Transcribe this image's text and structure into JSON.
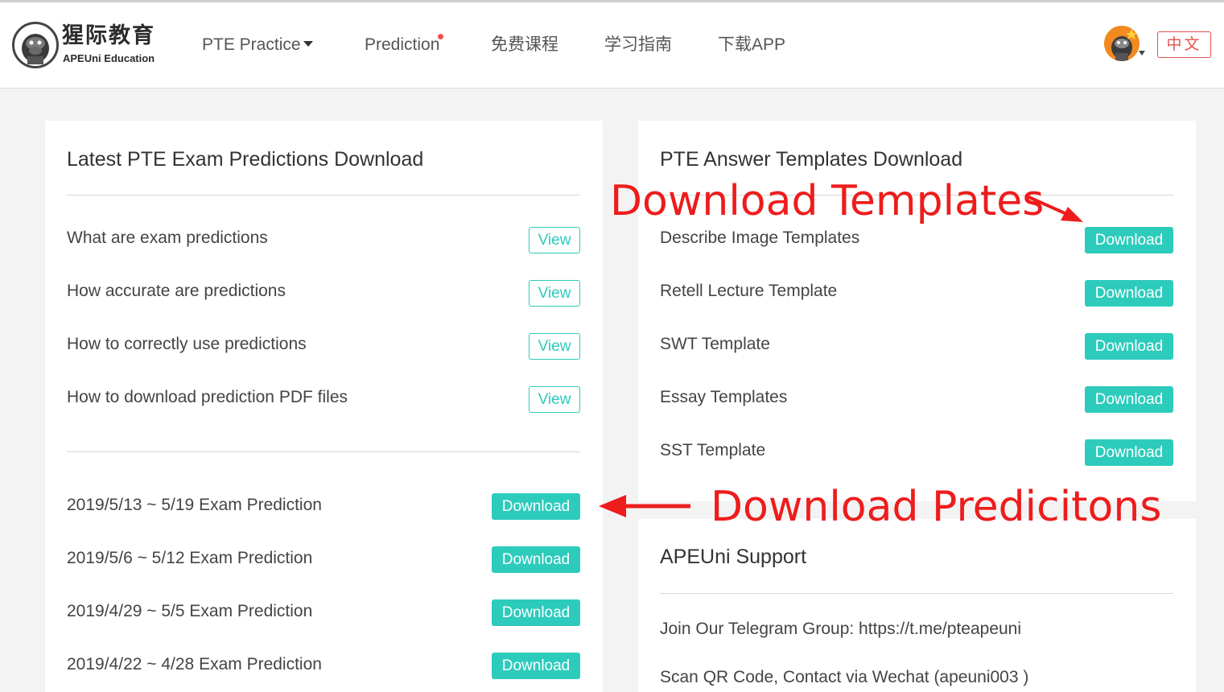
{
  "header": {
    "logo_cn": "猩际教育",
    "logo_en": "APEUni Education",
    "nav": [
      {
        "label": "PTE Practice",
        "has_caret": true
      },
      {
        "label": "Prediction",
        "has_dot": true
      },
      {
        "label": "免费课程"
      },
      {
        "label": "学习指南"
      },
      {
        "label": "下载APP"
      }
    ],
    "lang_button": "中文"
  },
  "predictions_card": {
    "title": "Latest PTE Exam Predictions Download",
    "info_rows": [
      {
        "label": "What are exam predictions",
        "button": "View"
      },
      {
        "label": "How accurate are predictions",
        "button": "View"
      },
      {
        "label": "How to correctly use predictions",
        "button": "View"
      },
      {
        "label": "How to download prediction PDF files",
        "button": "View"
      }
    ],
    "download_rows": [
      {
        "label": "2019/5/13 ~ 5/19 Exam Prediction",
        "button": "Download"
      },
      {
        "label": "2019/5/6 ~ 5/12 Exam Prediction",
        "button": "Download"
      },
      {
        "label": "2019/4/29 ~ 5/5 Exam Prediction",
        "button": "Download"
      },
      {
        "label": "2019/4/22 ~ 4/28 Exam Prediction",
        "button": "Download"
      }
    ]
  },
  "templates_card": {
    "title": "PTE Answer Templates Download",
    "rows": [
      {
        "label": "Describe Image Templates",
        "button": "Download"
      },
      {
        "label": "Retell Lecture Template",
        "button": "Download"
      },
      {
        "label": "SWT Template",
        "button": "Download"
      },
      {
        "label": "Essay Templates",
        "button": "Download"
      },
      {
        "label": "SST Template",
        "button": "Download"
      }
    ]
  },
  "support_card": {
    "title": "APEUni Support",
    "lines": [
      "Join Our Telegram Group: https://t.me/pteapeuni",
      "Scan QR Code, Contact via Wechat (apeuni003 )"
    ]
  },
  "annotations": {
    "templates": "Download Templates",
    "predictions": "Download Predicitons"
  },
  "colors": {
    "accent": "#2dcbbc",
    "annotation": "#ee1c1c",
    "lang_button": "#e0524f"
  }
}
